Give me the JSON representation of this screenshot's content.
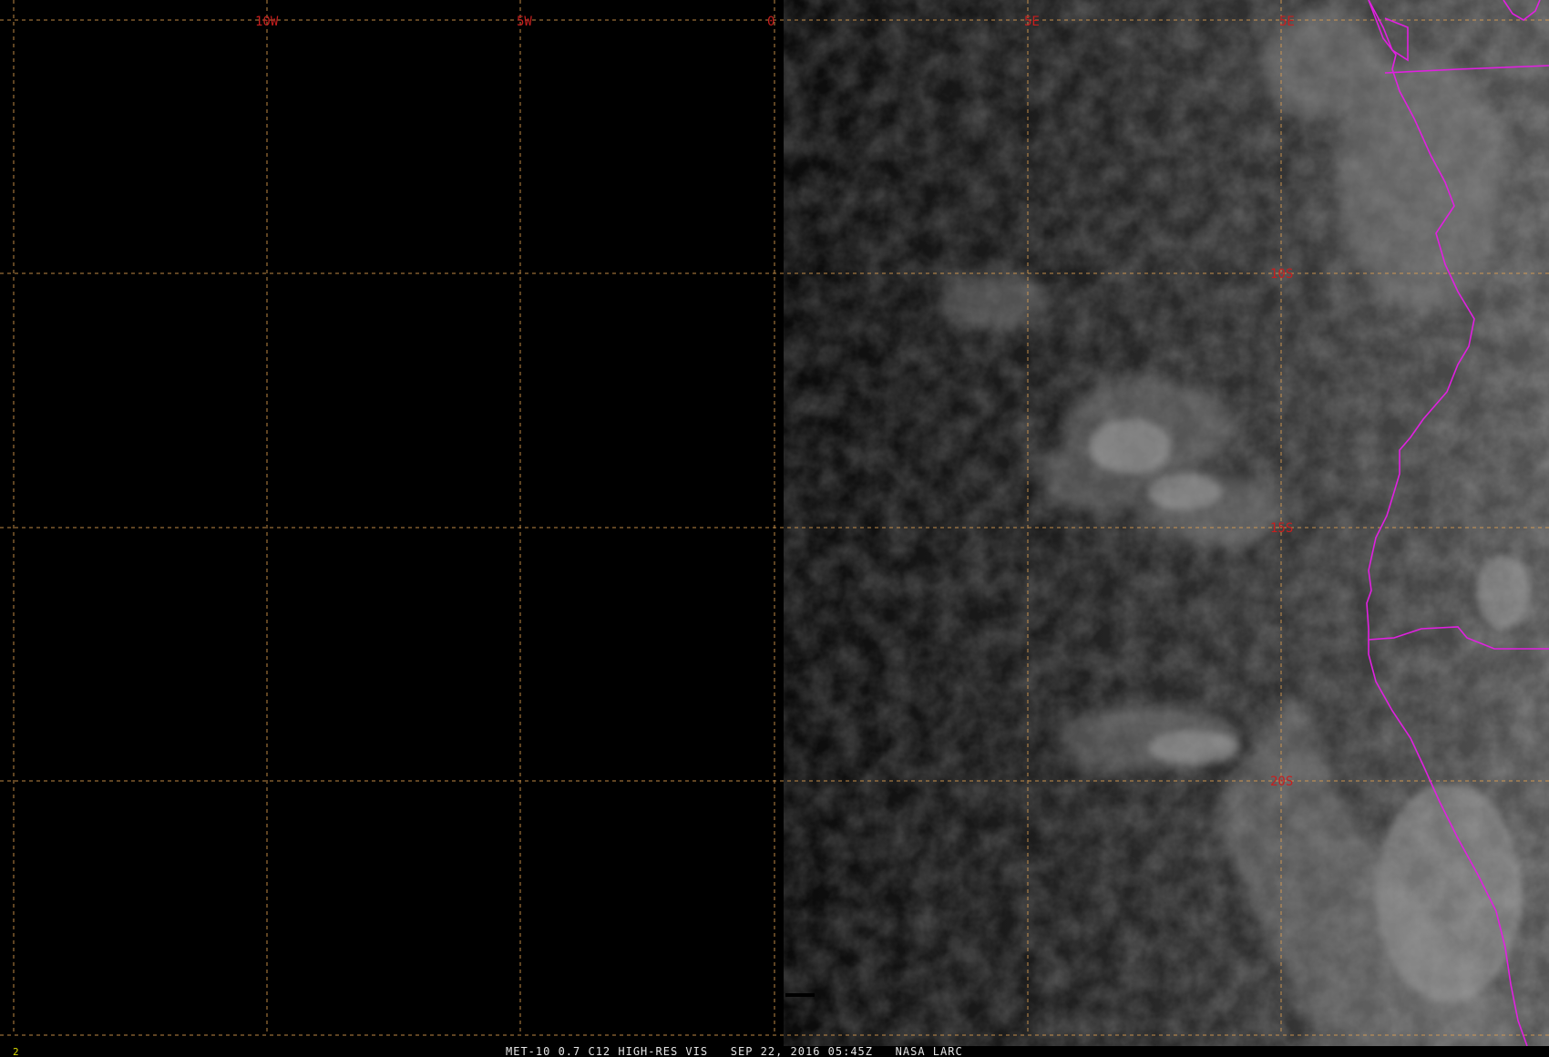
{
  "map": {
    "grid": {
      "line_color": "#e0a050",
      "lon_labels": [
        "10W",
        "5W",
        "0",
        "5E",
        "5E"
      ],
      "lat_labels": [
        "10S",
        "15S",
        "20S"
      ]
    },
    "label_color": "#c81e1e",
    "border_color": "#e020e0"
  },
  "footer": {
    "frame_number": "2",
    "caption": "MET-10 0.7 C12 HIGH-RES VIS   SEP 22, 2016 05:45Z   NASA LARC"
  }
}
